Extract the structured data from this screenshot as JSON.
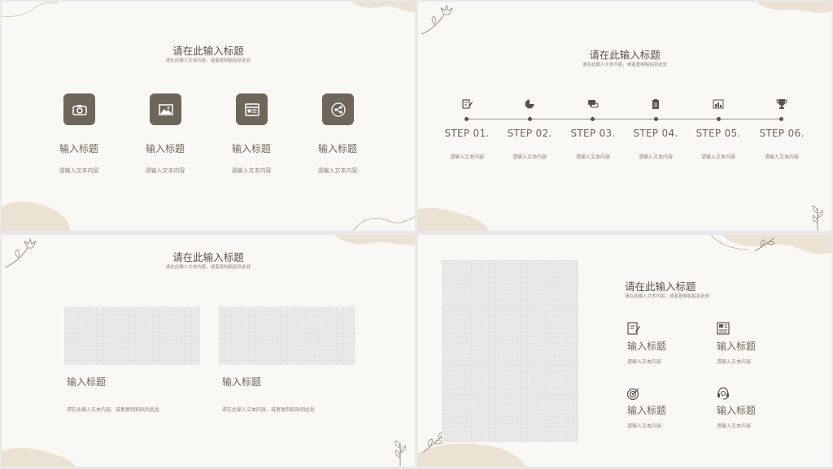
{
  "colors": {
    "background": "#faf8f4",
    "accent": "#6f665a",
    "blob": "#ece2d4",
    "text": "#6f665b"
  },
  "slide1": {
    "title": "请在此输入标题",
    "subtitle": "请在此输入文本内容，或者复制粘贴到此处",
    "items": [
      {
        "icon": "camera-icon",
        "title": "输入标题",
        "desc": "请输入文本内容"
      },
      {
        "icon": "image-icon",
        "title": "输入标题",
        "desc": "请输入文本内容"
      },
      {
        "icon": "browser-window-icon",
        "title": "输入标题",
        "desc": "请输入文本内容"
      },
      {
        "icon": "share-icon",
        "title": "输入标题",
        "desc": "请输入文本内容"
      }
    ]
  },
  "slide2": {
    "title": "请在此输入标题",
    "subtitle": "请在此输入文本内容，或者复制粘贴到此处",
    "steps": [
      {
        "icon": "document-edit-icon",
        "label": "STEP 01.",
        "desc": "请输入文本内容"
      },
      {
        "icon": "pie-chart-icon",
        "label": "STEP 02.",
        "desc": "请输入文本内容"
      },
      {
        "icon": "chat-bubbles-icon",
        "label": "STEP 03.",
        "desc": "请输入文本内容"
      },
      {
        "icon": "clipboard-icon",
        "label": "STEP 04.",
        "desc": "请输入文本内容"
      },
      {
        "icon": "bar-chart-icon",
        "label": "STEP 05.",
        "desc": "请输入文本内容"
      },
      {
        "icon": "trophy-icon",
        "label": "STEP 06.",
        "desc": "请输入文本内容"
      }
    ]
  },
  "slide3": {
    "title": "请在此输入标题",
    "subtitle": "请在此输入文本内容，或者复制粘贴到此处",
    "cards": [
      {
        "title": "输入标题",
        "desc": "请在此输入文本内容，或者复制粘贴到此处"
      },
      {
        "title": "输入标题",
        "desc": "请在此输入文本内容，或者复制粘贴到此处"
      }
    ]
  },
  "slide4": {
    "title": "请在此输入标题",
    "subtitle": "请在此输入文本内容，或者复制粘贴到此处",
    "items": [
      {
        "icon": "document-edit-icon",
        "title": "输入标题",
        "desc": "请输入文本内容"
      },
      {
        "icon": "newspaper-icon",
        "title": "输入标题",
        "desc": "请输入文本内容"
      },
      {
        "icon": "target-icon",
        "title": "输入标题",
        "desc": "请输入文本内容"
      },
      {
        "icon": "headset-icon",
        "title": "输入标题",
        "desc": "请输入文本内容"
      }
    ]
  }
}
